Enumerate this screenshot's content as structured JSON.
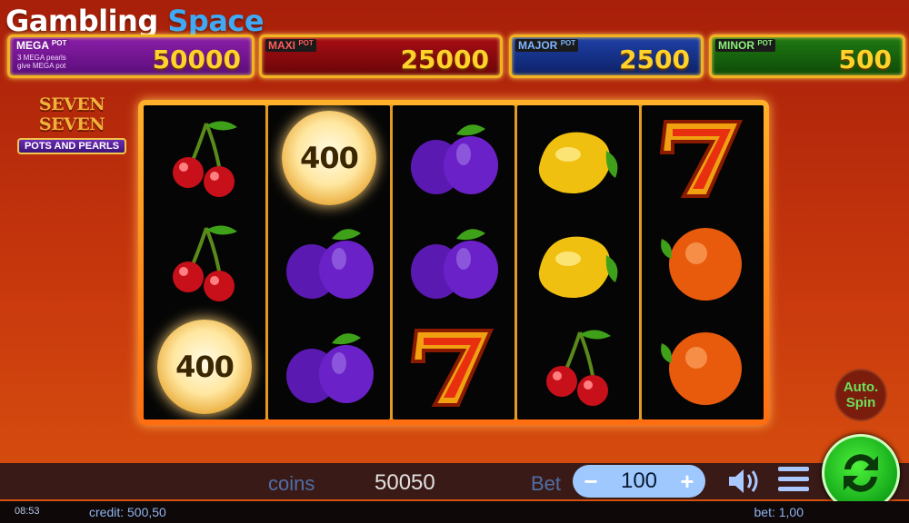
{
  "brand": {
    "part1": "Gambling",
    "part2": "Space"
  },
  "jackpots": [
    {
      "tag": "MEGA",
      "suffix": "POT",
      "value": "50000",
      "note1": "3 MEGA pearls",
      "note2": "give MEGA pot"
    },
    {
      "tag": "MAXI",
      "suffix": "POT",
      "value": "25000"
    },
    {
      "tag": "MAJOR",
      "suffix": "POT",
      "value": "2500"
    },
    {
      "tag": "MINOR",
      "suffix": "POT",
      "value": "500"
    }
  ],
  "logo": {
    "line1": "SEVEN SEVEN",
    "line2": "POTS AND PEARLS"
  },
  "reels": [
    [
      "cherry",
      "cherry",
      "pearl"
    ],
    [
      "pearl",
      "plum",
      "plum"
    ],
    [
      "plum",
      "plum",
      "seven"
    ],
    [
      "lemon",
      "lemon",
      "cherry"
    ],
    [
      "seven",
      "orange",
      "orange"
    ]
  ],
  "pearl_value": "400",
  "autospin": {
    "line1": "Auto.",
    "line2": "Spin"
  },
  "bar": {
    "coins_label": "coins",
    "coins_value": "50050",
    "bet_label": "Bet",
    "bet_value": "100",
    "minus": "−",
    "plus": "+"
  },
  "footer": {
    "time": "08:53",
    "credit": "credit: 500,50",
    "bet": "bet: 1,00"
  },
  "colors": {
    "mega": "#8a1ea8",
    "maxi": "#a80e14",
    "major": "#1e40a8",
    "minor": "#1f7a12",
    "spin": "#14a81a",
    "jackpot_value": "#ffd32a"
  }
}
